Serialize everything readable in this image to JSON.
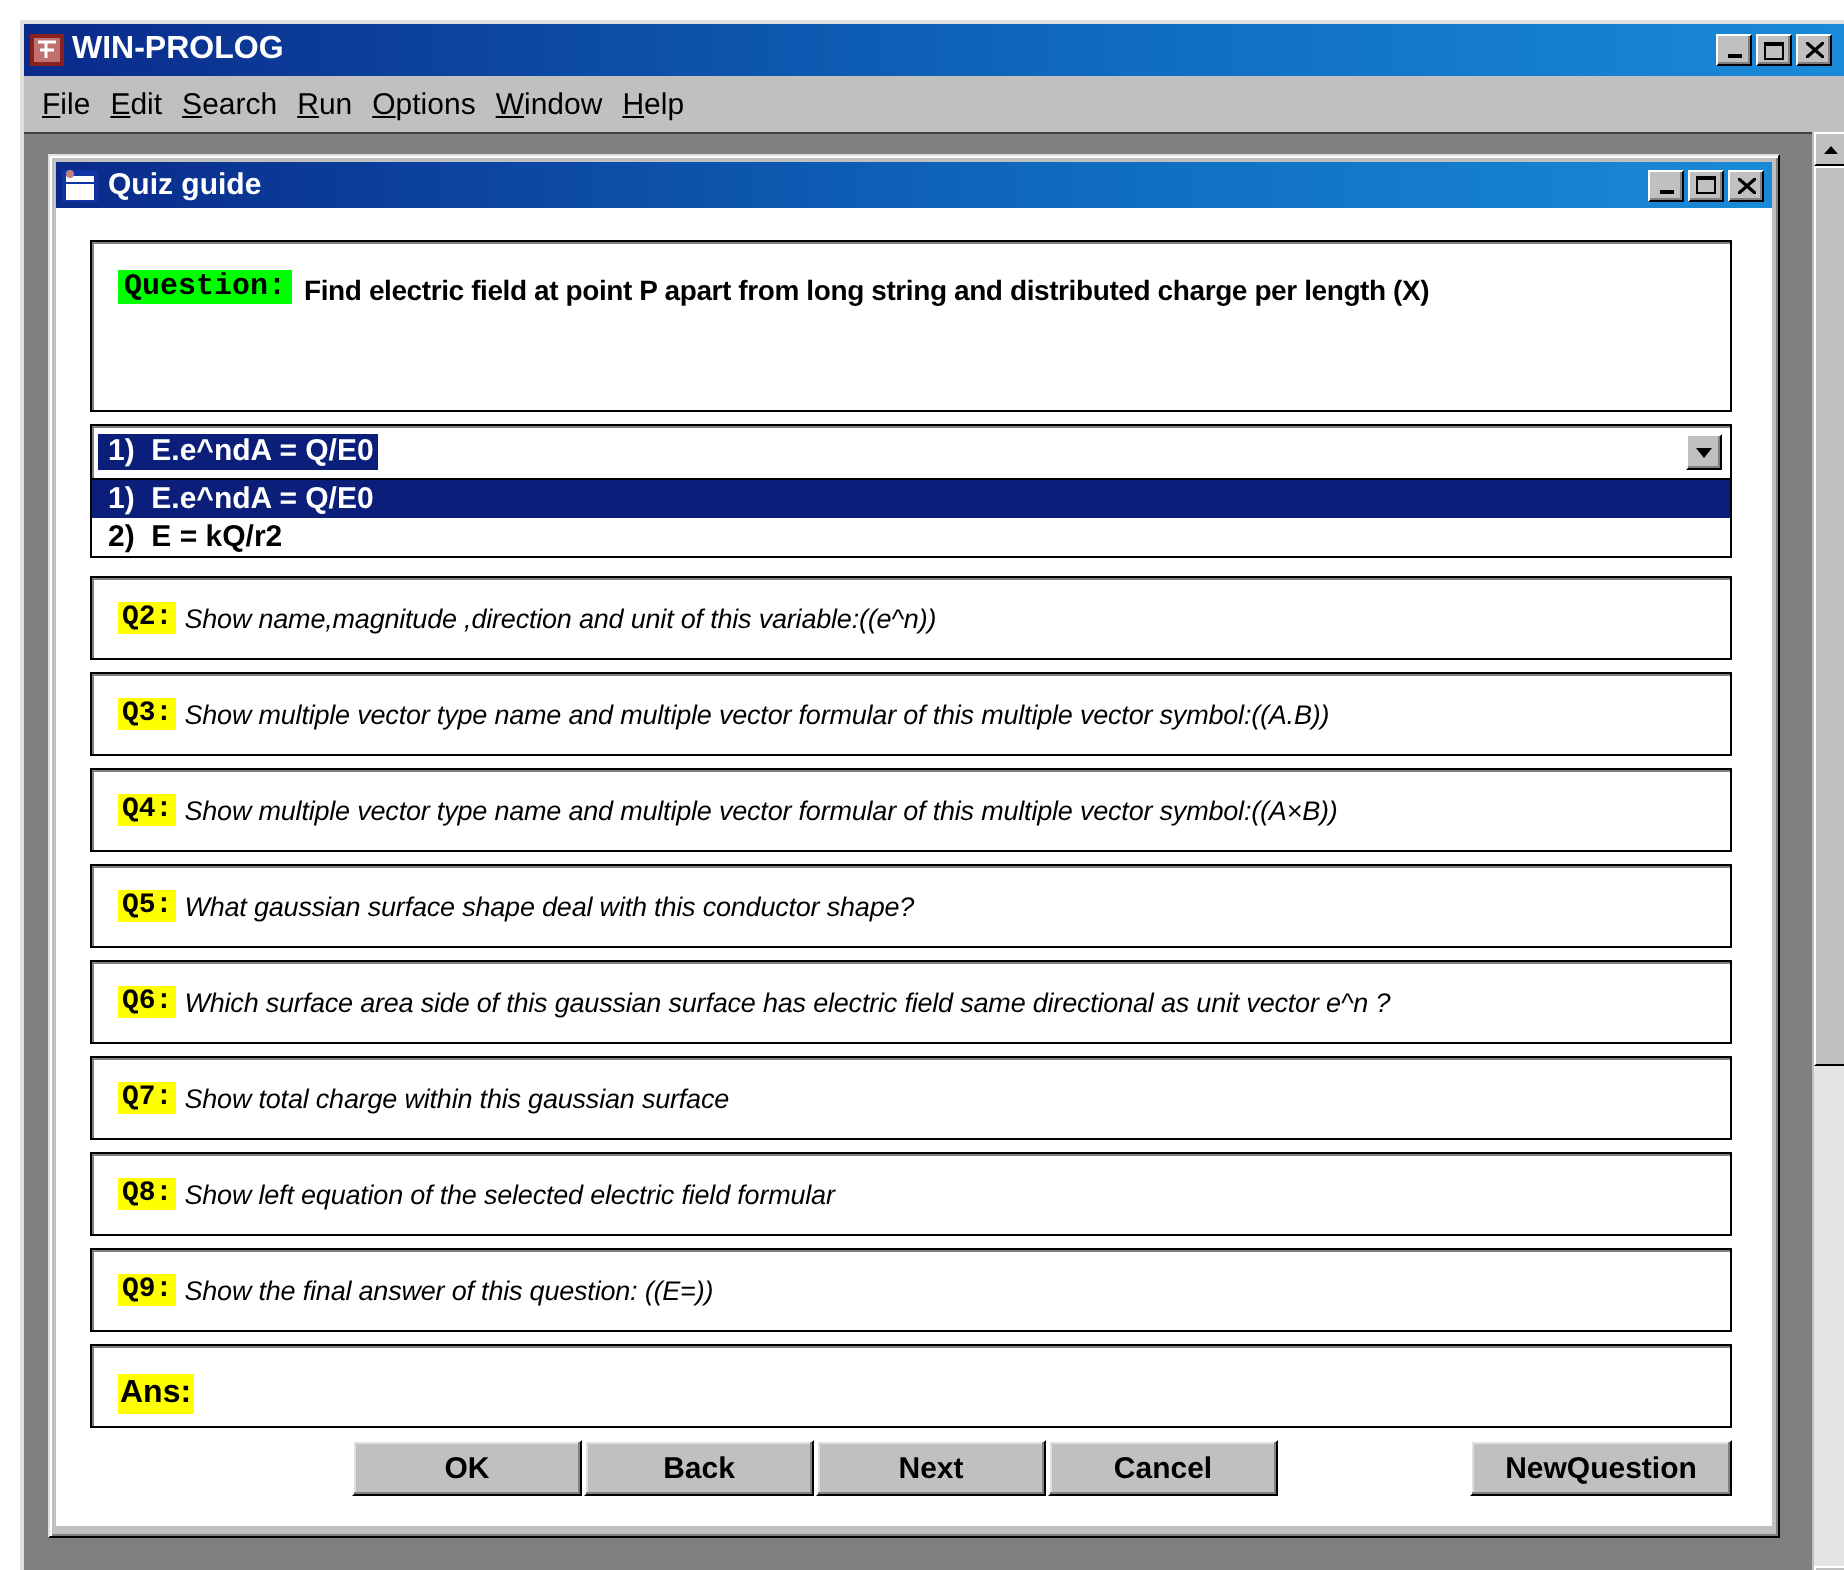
{
  "window": {
    "title": "WIN-PROLOG"
  },
  "menu": [
    "File",
    "Edit",
    "Search",
    "Run",
    "Options",
    "Window",
    "Help"
  ],
  "dialog": {
    "title": "Quiz guide"
  },
  "question": {
    "label": "Question:",
    "text": "Find electric field at point P apart from long string and distributed charge per length (X)"
  },
  "formula_select": {
    "value": "1)  E.e^ndA = Q/E0",
    "expanded": true,
    "options": [
      {
        "label": "1)  E.e^ndA = Q/E0",
        "selected": true
      },
      {
        "label": "2)  E = kQ/r2",
        "selected": false
      }
    ]
  },
  "prompts": [
    {
      "label": "Q2:",
      "text": "Show name,magnitude ,direction and unit of this variable:((e^n))"
    },
    {
      "label": "Q3:",
      "text": "Show multiple vector type name and multiple vector formular of this multiple vector symbol:((A.B))"
    },
    {
      "label": "Q4:",
      "text": "Show multiple vector type name and multiple vector formular of this multiple vector symbol:((A×B))"
    },
    {
      "label": "Q5:",
      "text": "What gaussian surface shape deal with this conductor shape?"
    },
    {
      "label": "Q6:",
      "text": "Which surface area side of this gaussian surface has electric field same directional as unit vector e^n ?"
    },
    {
      "label": "Q7:",
      "text": "Show total charge within this gaussian surface"
    },
    {
      "label": "Q8:",
      "text": "Show left equation of the selected electric field formular"
    },
    {
      "label": "Q9:",
      "text": "Show the final answer of this question: ((E=))"
    }
  ],
  "answer": {
    "label": "Ans:"
  },
  "buttons": [
    "OK",
    "Back",
    "Next",
    "Cancel"
  ],
  "new_question_button": "NewQuestion"
}
